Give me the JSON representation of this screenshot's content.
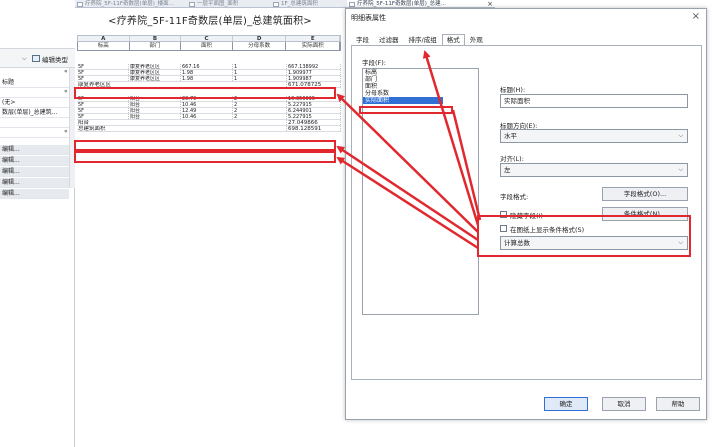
{
  "tabs": [
    {
      "label": "疗养院_5F-11F奇数层(单层)_楼面..."
    },
    {
      "label": "一层平面图_面积"
    },
    {
      "label": "1F_总建筑面积"
    },
    {
      "label": "疗养院_5F-11F奇数层(单层)_总建...",
      "close": "×"
    }
  ],
  "left_panel": {
    "edit_type_label": "编辑类型",
    "collapse_icon": "«",
    "rows": [
      "标题",
      "",
      "(无>",
      "数层(单层)_总建筑...",
      "",
      "",
      "",
      "",
      "编辑...",
      "编辑...",
      "编辑...",
      "编辑...",
      "编辑..."
    ]
  },
  "schedule": {
    "title": "<疗养院_5F-11F奇数层(单层)_总建筑面积>",
    "col_letters": [
      "A",
      "B",
      "C",
      "D",
      "E"
    ],
    "col_headers": [
      "标高",
      "部门",
      "面积",
      "分母系数",
      "实际面积"
    ],
    "groups": [
      {
        "rows": [
          [
            "5F",
            "康复养老区区",
            "667.16",
            "1",
            "667.138992"
          ],
          [
            "5F",
            "康复养老区区",
            "1.98",
            "1",
            "1.909977"
          ],
          [
            "5F",
            "康复养老区区",
            "1.98",
            "1",
            "1.909987"
          ]
        ],
        "subtotal_label": "康复养老区区",
        "subtotal_value": "671.078725"
      },
      {
        "rows": [
          [
            "5F",
            "阳台",
            "20.70",
            "2",
            "10.350035"
          ],
          [
            "5F",
            "阳台",
            "10.46",
            "2",
            "5.227915"
          ],
          [
            "5F",
            "阳台",
            "12.49",
            "2",
            "6.244901"
          ],
          [
            "5F",
            "阳台",
            "10.46",
            "2",
            "5.227915"
          ]
        ],
        "subtotal_label": "阳台",
        "subtotal_value": "27.049866"
      }
    ],
    "grand_label": "总建筑面积",
    "grand_value": "698.128591"
  },
  "dialog": {
    "title": "明细表属性",
    "close": "×",
    "tabs": [
      "字段",
      "过滤器",
      "排序/成组",
      "格式",
      "外观"
    ],
    "active_tab": "格式",
    "fields_label": "字段(F):",
    "fields": [
      "标高",
      "部门",
      "面积",
      "分母系数",
      "实际面积"
    ],
    "selected_field": "实际面积",
    "heading_label": "标题(H):",
    "heading_value": "实际面积",
    "heading_orientation_label": "标题方向(E):",
    "heading_orientation_value": "水平",
    "alignment_label": "对齐(L):",
    "alignment_value": "左",
    "field_format_label": "字段格式:",
    "field_format_button": "字段格式(O)...",
    "hidden_field_label": "隐藏字段(I)",
    "conditional_format_button": "条件格式(N)...",
    "show_conditional_label": "在图纸上显示条件格式(S)",
    "calc_value": "计算总数",
    "ok": "确定",
    "cancel": "取消",
    "help": "帮助"
  }
}
